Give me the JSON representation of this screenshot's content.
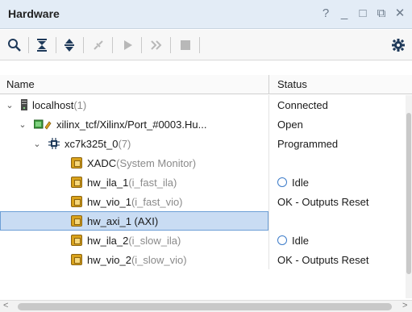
{
  "panel": {
    "title": "Hardware"
  },
  "window_controls": [
    "?",
    "_",
    "□",
    "⧉",
    "✕"
  ],
  "toolbar": {
    "buttons": [
      {
        "icon": "search-icon"
      },
      {
        "icon": "collapse-all-icon"
      },
      {
        "icon": "expand-all-icon"
      },
      {
        "icon": "connect-icon"
      },
      {
        "icon": "run-icon"
      },
      {
        "icon": "fast-forward-icon"
      },
      {
        "icon": "stop-icon"
      },
      {
        "icon": "gear-icon"
      }
    ]
  },
  "columns": {
    "name": "Name",
    "status": "Status"
  },
  "rows": [
    {
      "label": "localhost",
      "suffix": " (1)",
      "status": "Connected"
    },
    {
      "label": "xilinx_tcf/Xilinx/Port_#0003.Hu...",
      "suffix": "",
      "status": "Open"
    },
    {
      "label": "xc7k325t_0",
      "suffix": " (7)",
      "status": "Programmed"
    },
    {
      "label": "XADC",
      "suffix": " (System Monitor)",
      "status": ""
    },
    {
      "label": "hw_ila_1",
      "suffix": " (i_fast_ila)",
      "status": "Idle"
    },
    {
      "label": "hw_vio_1",
      "suffix": " (i_fast_vio)",
      "status": "OK - Outputs Reset"
    },
    {
      "label": "hw_axi_1 (AXI)",
      "suffix": "",
      "status": ""
    },
    {
      "label": "hw_ila_2",
      "suffix": " (i_slow_ila)",
      "status": "Idle"
    },
    {
      "label": "hw_vio_2",
      "suffix": " (i_slow_vio)",
      "status": "OK - Outputs Reset"
    }
  ]
}
